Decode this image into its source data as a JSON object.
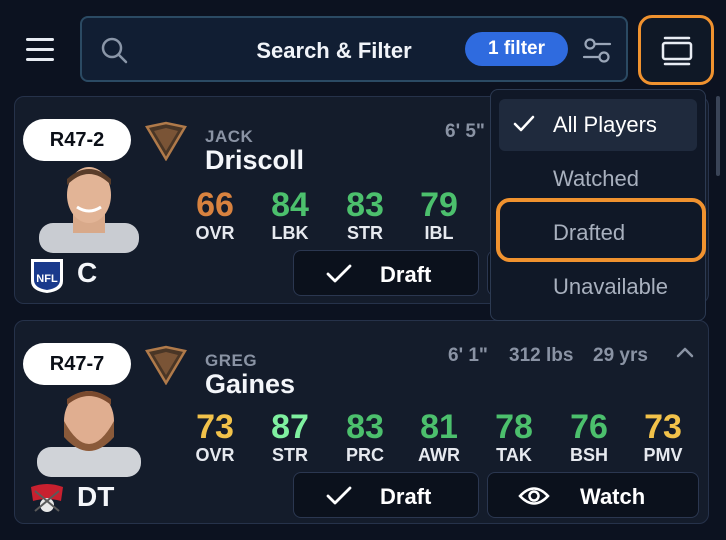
{
  "header": {
    "search_label": "Search & Filter",
    "filter_badge": "1 filter"
  },
  "dropdown": {
    "items": [
      {
        "label": "All Players",
        "selected": true
      },
      {
        "label": "Watched",
        "selected": false
      },
      {
        "label": "Drafted",
        "selected": false,
        "highlighted": true
      },
      {
        "label": "Unavailable",
        "selected": false
      }
    ]
  },
  "players": [
    {
      "rank": "R47-2",
      "first_name": "JACK",
      "last_name": "Driscoll",
      "height": "6' 5\"",
      "position": "C",
      "team": "NFL",
      "stats": [
        {
          "value": "66",
          "label": "OVR",
          "color": "#d8823f"
        },
        {
          "value": "84",
          "label": "LBK",
          "color": "#4cc06d"
        },
        {
          "value": "83",
          "label": "STR",
          "color": "#4cc06d"
        },
        {
          "value": "79",
          "label": "IBL",
          "color": "#4cc06d"
        }
      ],
      "buttons": {
        "draft": "Draft"
      }
    },
    {
      "rank": "R47-7",
      "first_name": "GREG",
      "last_name": "Gaines",
      "height": "6' 1\"",
      "weight": "312 lbs",
      "age": "29 yrs",
      "position": "DT",
      "team": "Buccaneers",
      "stats": [
        {
          "value": "73",
          "label": "OVR",
          "color": "#f2c24a"
        },
        {
          "value": "87",
          "label": "STR",
          "color": "#7ff0a0"
        },
        {
          "value": "83",
          "label": "PRC",
          "color": "#4cc06d"
        },
        {
          "value": "81",
          "label": "AWR",
          "color": "#4cc06d"
        },
        {
          "value": "78",
          "label": "TAK",
          "color": "#4cc06d"
        },
        {
          "value": "76",
          "label": "BSH",
          "color": "#4cc06d"
        },
        {
          "value": "73",
          "label": "PMV",
          "color": "#f2c24a"
        }
      ],
      "buttons": {
        "draft": "Draft",
        "watch": "Watch"
      }
    }
  ]
}
